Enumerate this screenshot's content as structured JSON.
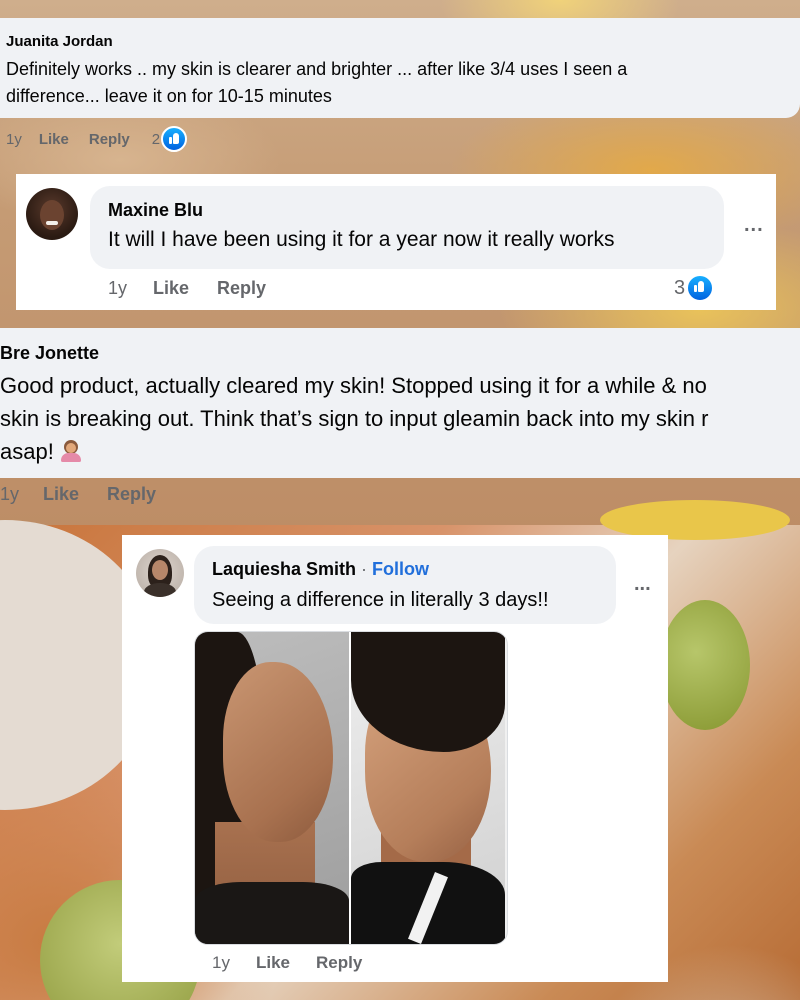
{
  "comments": [
    {
      "author": "Juanita Jordan",
      "text_lines": [
        "Definitely works .. my skin is clearer and brighter ... after like 3/4 uses I seen a",
        "difference... leave it on for 10-15 minutes"
      ],
      "time": "1y",
      "like_label": "Like",
      "reply_label": "Reply",
      "reactions": "2"
    },
    {
      "author": "Maxine Blu",
      "text_lines": [
        "It will I have been using it for a year now it really works"
      ],
      "time": "1y",
      "like_label": "Like",
      "reply_label": "Reply",
      "reactions": "3",
      "more_label": "..."
    },
    {
      "author": "Bre Jonette",
      "text_lines": [
        "Good product, actually cleared my skin! Stopped using it for a while & no",
        "skin is breaking out. Think that’s sign to input gleamin back into my skin r",
        "asap!"
      ],
      "time": "1y",
      "like_label": "Like",
      "reply_label": "Reply"
    },
    {
      "author": "Laquiesha Smith",
      "separator": "·",
      "follow_label": "Follow",
      "text_lines": [
        "Seeing a difference in literally 3 days!!"
      ],
      "time": "1y",
      "like_label": "Like",
      "reply_label": "Reply",
      "more_label": "..."
    }
  ],
  "icons": {
    "reaction": "like-thumbs-up-icon",
    "emoji": "person-gesturing-emoji"
  },
  "colors": {
    "bubble": "#f0f2f5",
    "text": "#050505",
    "meta": "#65676b",
    "follow": "#216fdb",
    "like_badge": "#0866ff"
  }
}
